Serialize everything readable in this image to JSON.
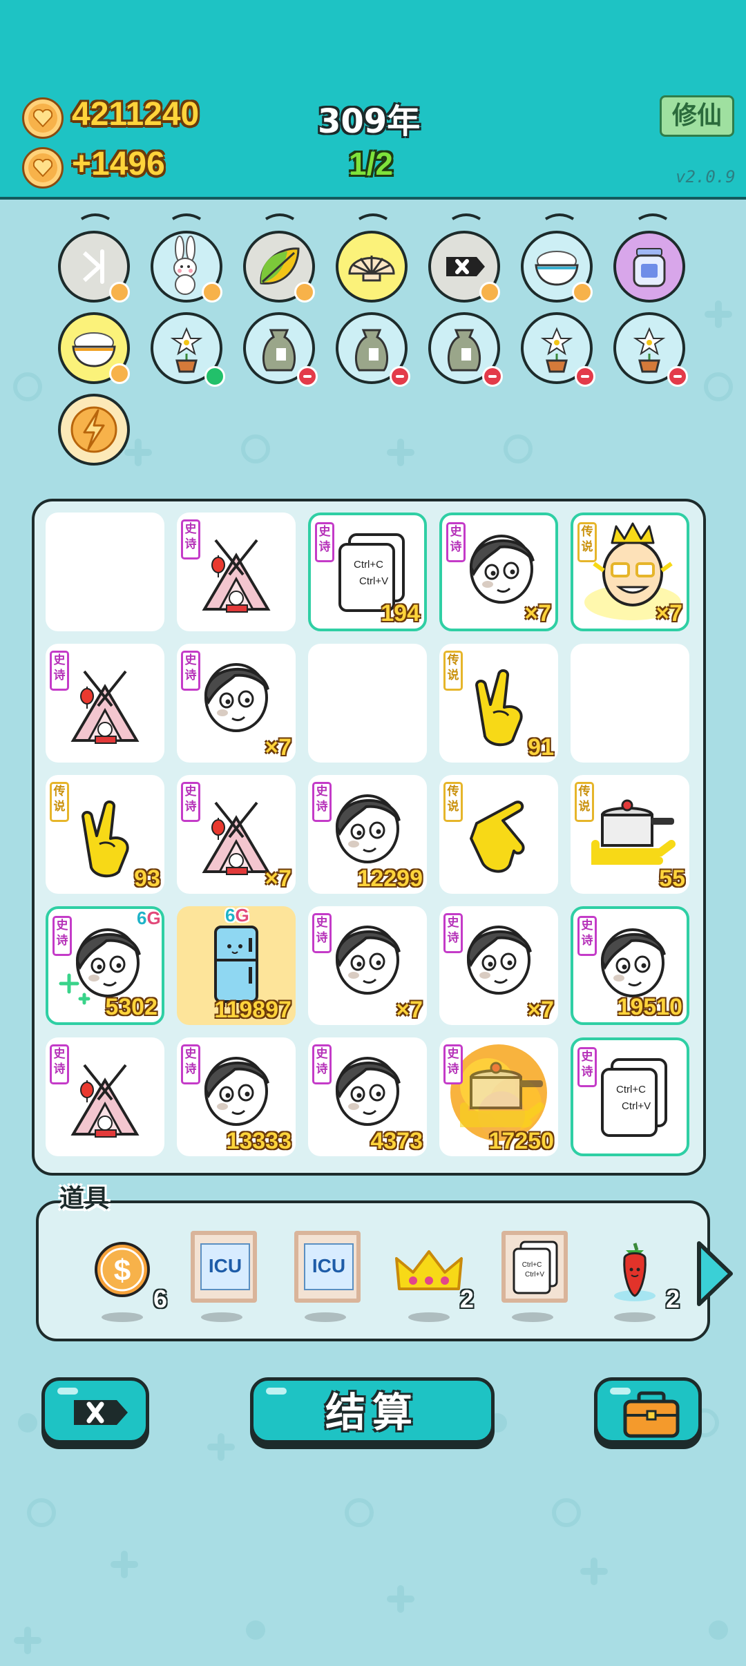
{
  "header": {
    "coins": "4211240",
    "income": "+1496",
    "year": "309年",
    "stage": "1/2",
    "cultivate_label": "修仙",
    "version": "v2.0.9"
  },
  "relics": [
    {
      "icon": "skip-icon",
      "status": "heart"
    },
    {
      "icon": "bunny-icon",
      "status": "heart"
    },
    {
      "icon": "leaf-icon",
      "status": "heart"
    },
    {
      "icon": "shell-icon",
      "status": ""
    },
    {
      "icon": "cancel-icon",
      "status": "heart"
    },
    {
      "icon": "rice-bowl-icon",
      "status": "heart"
    },
    {
      "icon": "jar-icon",
      "status": ""
    },
    {
      "icon": "rice-bowl-icon",
      "status": "heart"
    },
    {
      "icon": "flower-pot-icon",
      "status": "green"
    },
    {
      "icon": "sack-icon",
      "status": "red"
    },
    {
      "icon": "sack-icon",
      "status": "red"
    },
    {
      "icon": "sack-icon",
      "status": "red"
    },
    {
      "icon": "flower-pot-icon",
      "status": "red"
    },
    {
      "icon": "flower-pot-icon",
      "status": "red"
    },
    {
      "icon": "lightning-icon",
      "status": ""
    }
  ],
  "grid": {
    "rarity_epic": "史诗",
    "rarity_legend": "传说",
    "cells": [
      {
        "item": "empty",
        "rarity": "",
        "value": ""
      },
      {
        "item": "tent",
        "rarity": "epic",
        "value": ""
      },
      {
        "item": "copy-paste",
        "rarity": "epic",
        "value": "194"
      },
      {
        "item": "face",
        "rarity": "epic",
        "value": "×7"
      },
      {
        "item": "king",
        "rarity": "legend",
        "value": "×7"
      },
      {
        "item": "tent",
        "rarity": "epic",
        "value": ""
      },
      {
        "item": "face",
        "rarity": "epic",
        "value": "×7"
      },
      {
        "item": "empty",
        "rarity": "",
        "value": ""
      },
      {
        "item": "rock-hand",
        "rarity": "legend",
        "value": "91"
      },
      {
        "item": "empty",
        "rarity": "",
        "value": ""
      },
      {
        "item": "rock-hand",
        "rarity": "legend",
        "value": "93"
      },
      {
        "item": "tent",
        "rarity": "epic",
        "value": "×7"
      },
      {
        "item": "face",
        "rarity": "epic",
        "value": "12299"
      },
      {
        "item": "point-hand",
        "rarity": "legend",
        "value": ""
      },
      {
        "item": "pressure-cooker",
        "rarity": "legend",
        "value": "55"
      },
      {
        "item": "face-sparkle",
        "rarity": "epic",
        "value": "5302"
      },
      {
        "item": "fridge",
        "rarity": "",
        "value": "119897"
      },
      {
        "item": "face",
        "rarity": "epic",
        "value": "×7"
      },
      {
        "item": "face",
        "rarity": "epic",
        "value": "×7"
      },
      {
        "item": "face",
        "rarity": "epic",
        "value": "19510"
      },
      {
        "item": "tent",
        "rarity": "epic",
        "value": ""
      },
      {
        "item": "face",
        "rarity": "epic",
        "value": "13333"
      },
      {
        "item": "face",
        "rarity": "epic",
        "value": "4373"
      },
      {
        "item": "exploding-cooker",
        "rarity": "epic",
        "value": "17250"
      },
      {
        "item": "copy-paste",
        "rarity": "epic",
        "value": ""
      }
    ],
    "badge_6": "6",
    "badge_g": "G"
  },
  "items": {
    "title": "道具",
    "list": [
      {
        "icon": "dollar-coin-icon",
        "count": "6"
      },
      {
        "icon": "icu-card-icon",
        "count": "",
        "label": "ICU"
      },
      {
        "icon": "icu-card-icon",
        "count": "",
        "label": "ICU"
      },
      {
        "icon": "crown-icon",
        "count": "2"
      },
      {
        "icon": "copy-card-icon",
        "count": ""
      },
      {
        "icon": "chili-icon",
        "count": "2"
      }
    ],
    "copy_label": "Ctrl+C",
    "paste_label": "Ctrl+V"
  },
  "buttons": {
    "settle_label": "结算"
  },
  "colors": {
    "header": "#1ec3c4",
    "background": "#a9dde4",
    "coin_text": "#ffd43b",
    "stage_text": "#7ee23b"
  }
}
